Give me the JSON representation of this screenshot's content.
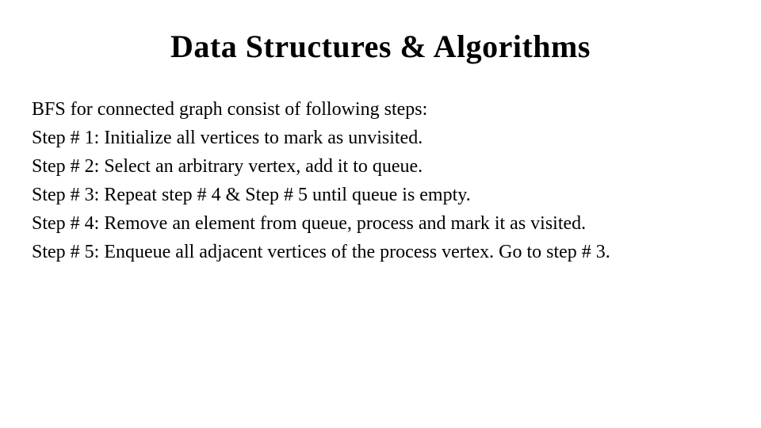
{
  "title": "Data Structures & Algorithms",
  "lines": {
    "intro": "BFS for connected graph consist of following steps:",
    "step1": "Step # 1: Initialize all vertices to mark as unvisited.",
    "step2": "Step # 2: Select an arbitrary vertex, add it to queue.",
    "step3": "Step # 3: Repeat  step # 4 & Step # 5 until queue is empty.",
    "step4": "Step # 4: Remove an element from queue, process and mark it as visited.",
    "step5": "Step # 5: Enqueue all adjacent vertices of the process vertex. Go to step # 3."
  }
}
